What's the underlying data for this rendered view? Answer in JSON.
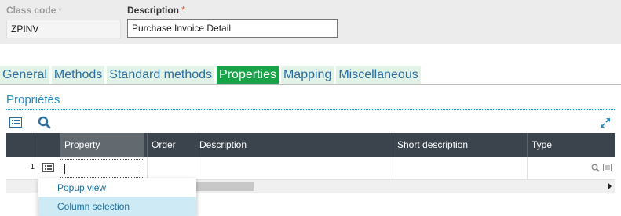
{
  "header": {
    "class_code": {
      "label": "Class code",
      "required_mark": "*",
      "value": "ZPINV"
    },
    "description": {
      "label": "Description",
      "required_mark": "*",
      "value": "Purchase Invoice Detail"
    }
  },
  "tabs": [
    {
      "label": "General",
      "active": false
    },
    {
      "label": "Methods",
      "active": false
    },
    {
      "label": "Standard methods",
      "active": false
    },
    {
      "label": "Properties",
      "active": true
    },
    {
      "label": "Mapping",
      "active": false
    },
    {
      "label": "Miscellaneous",
      "active": false
    }
  ],
  "section": {
    "title": "Propriétés"
  },
  "toolbar": {
    "list_icon": "list-view-icon",
    "search_icon": "search-icon",
    "expand_icon": "expand-icon"
  },
  "grid": {
    "columns": [
      "",
      "",
      "Property",
      "Order",
      "Description",
      "Short description",
      "Type"
    ],
    "rows": [
      {
        "row_number": "1",
        "property": "",
        "order": "",
        "description": "",
        "short_description": "",
        "type": ""
      }
    ]
  },
  "context_menu": {
    "items": [
      {
        "label": "Popup view",
        "highlighted": false
      },
      {
        "label": "Column selection",
        "highlighted": true
      }
    ]
  },
  "colors": {
    "active_tab": "#19a349",
    "tab_background": "#e3f2e6",
    "tab_text": "#2a6fa0",
    "grid_header": "#3b434c",
    "required_star": "#e4562a",
    "section_title": "#2a8bbd",
    "menu_highlight": "#cdeaf5"
  }
}
